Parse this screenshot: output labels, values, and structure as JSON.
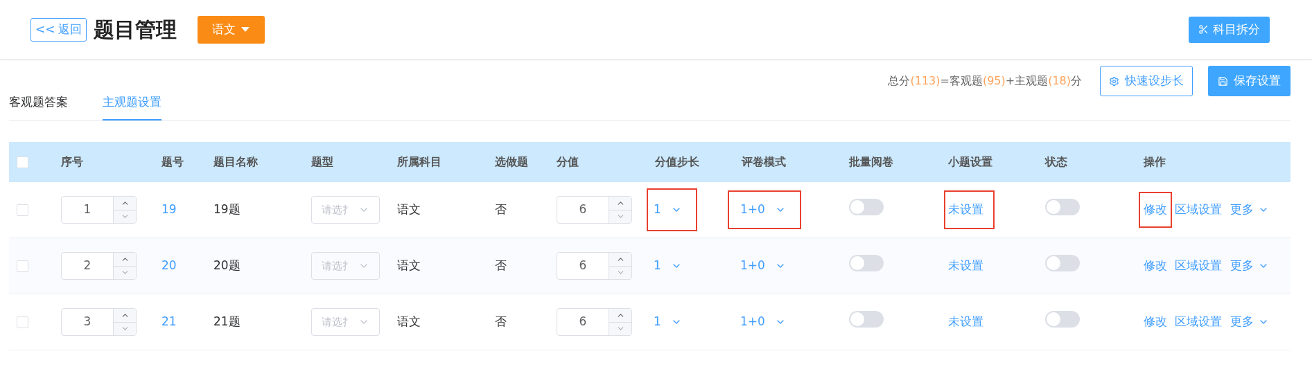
{
  "header": {
    "back_button": {
      "icon": "<<",
      "label": "返回"
    },
    "title": "题目管理",
    "subject_dropdown": "语文",
    "split_button": "科目拆分"
  },
  "tabs": [
    {
      "label": "客观题答案",
      "selected": false
    },
    {
      "label": "主观题设置",
      "selected": true
    }
  ],
  "summary": "总分**(113)**=客观题**(95)**+主观题**(18)**分",
  "actions": {
    "quick_step_button": "快速设步长",
    "save_button": "保存设置"
  },
  "table": {
    "select_all_checked": false,
    "columns": [
      "序号",
      "题号",
      "题目名称",
      "题型",
      "所属科目",
      "选做题",
      "分值",
      "分值步长",
      "评卷模式",
      "批量阅卷",
      "小题设置",
      "状态",
      "操作"
    ],
    "rows": [
      {
        "checked": false,
        "order": "1",
        "number": "19",
        "name": "19题",
        "type_placeholder": "请选扌",
        "subject": "语文",
        "optional": "否",
        "score": "6",
        "step": "1",
        "mode": "1+0",
        "batch_on": false,
        "sub_setting": "未设置",
        "status_on": false,
        "edit": "修改",
        "region": "区域设置",
        "more": "更多",
        "step_highlighted": true,
        "mode_highlighted": true,
        "sub_highlighted": true,
        "edit_highlighted": true
      },
      {
        "checked": false,
        "order": "2",
        "number": "20",
        "name": "20题",
        "type_placeholder": "请选扌",
        "subject": "语文",
        "optional": "否",
        "score": "6",
        "step": "1",
        "mode": "1+0",
        "batch_on": false,
        "sub_setting": "未设置",
        "status_on": false,
        "edit": "修改",
        "region": "区域设置",
        "more": "更多",
        "step_highlighted": false,
        "mode_highlighted": false,
        "sub_highlighted": false,
        "edit_highlighted": false
      },
      {
        "checked": false,
        "order": "3",
        "number": "21",
        "name": "21题",
        "type_placeholder": "请选扌",
        "subject": "语文",
        "optional": "否",
        "score": "6",
        "step": "1",
        "mode": "1+0",
        "batch_on": false,
        "sub_setting": "未设置",
        "status_on": false,
        "edit": "修改",
        "region": "区域设置",
        "more": "更多",
        "step_highlighted": false,
        "mode_highlighted": false,
        "sub_highlighted": false,
        "edit_highlighted": false
      }
    ]
  }
}
